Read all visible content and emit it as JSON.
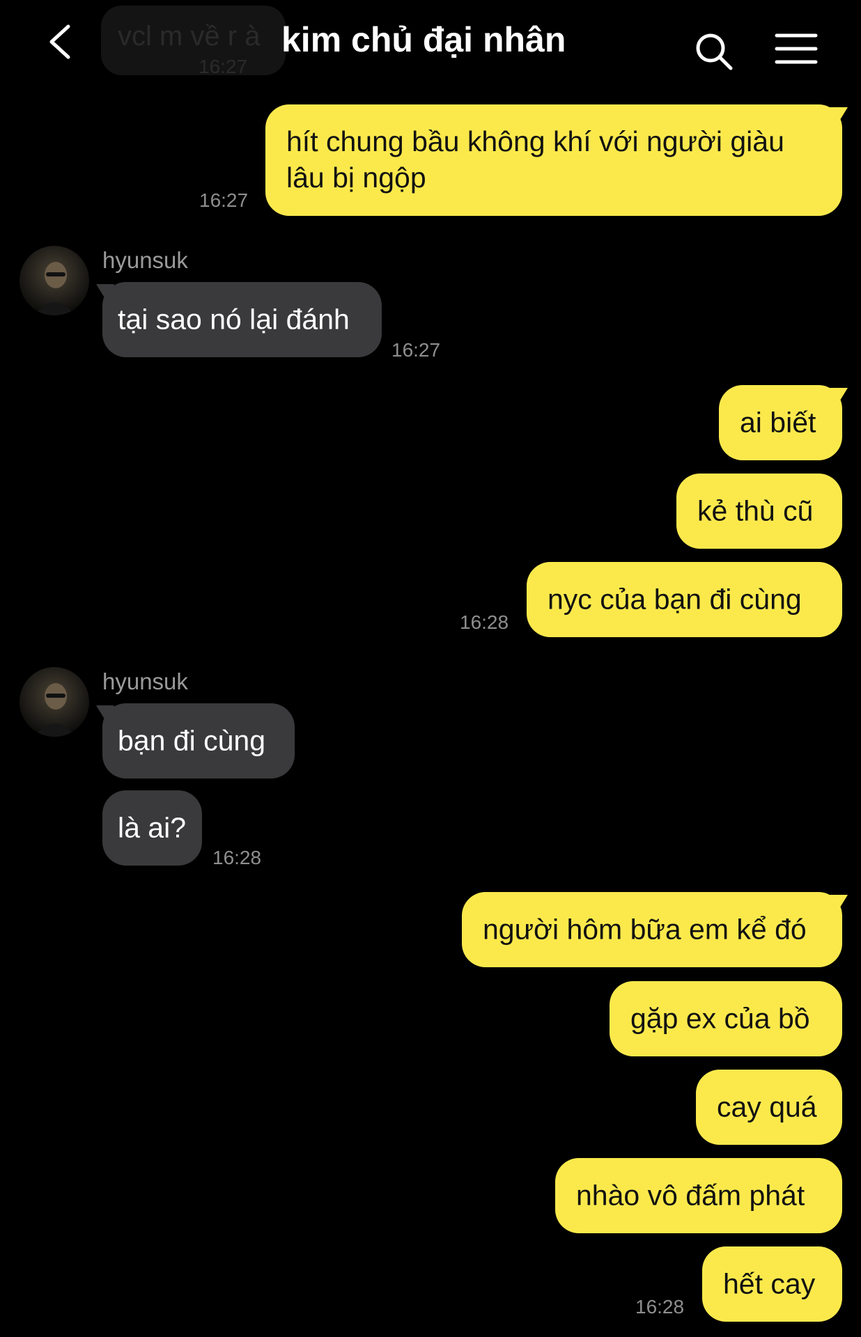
{
  "header": {
    "title": "kim chủ đại nhân",
    "back_icon": "chevron-left-icon",
    "search_icon": "search-icon",
    "menu_icon": "hamburger-menu-icon",
    "ghost_message": "vcl m về r à",
    "ghost_time": "16:27"
  },
  "colors": {
    "background": "#000000",
    "my_bubble": "#FBE94C",
    "their_bubble": "#3A3A3C",
    "timestamp": "#8E8E8E"
  },
  "messages": {
    "m1": {
      "text_line1": "hít chung bầu không khí với người giàu",
      "text_line2": "lâu bị ngộp",
      "time": "16:27"
    },
    "g1": {
      "sender": "hyunsuk",
      "text": "tại sao nó lại đánh",
      "time": "16:27"
    },
    "m2": {
      "text": "ai biết"
    },
    "m3": {
      "text": "kẻ thù cũ"
    },
    "m4": {
      "text": "nyc của bạn đi cùng",
      "time": "16:28"
    },
    "g2": {
      "sender": "hyunsuk",
      "text": "bạn đi cùng"
    },
    "g3": {
      "text": "là ai?",
      "time": "16:28"
    },
    "m5": {
      "text": "người hôm bữa em kể đó"
    },
    "m6": {
      "text": "gặp ex của bồ"
    },
    "m7": {
      "text": "cay quá"
    },
    "m8": {
      "text": "nhào vô đấm phát"
    },
    "m9": {
      "text": "hết cay",
      "time": "16:28"
    }
  }
}
